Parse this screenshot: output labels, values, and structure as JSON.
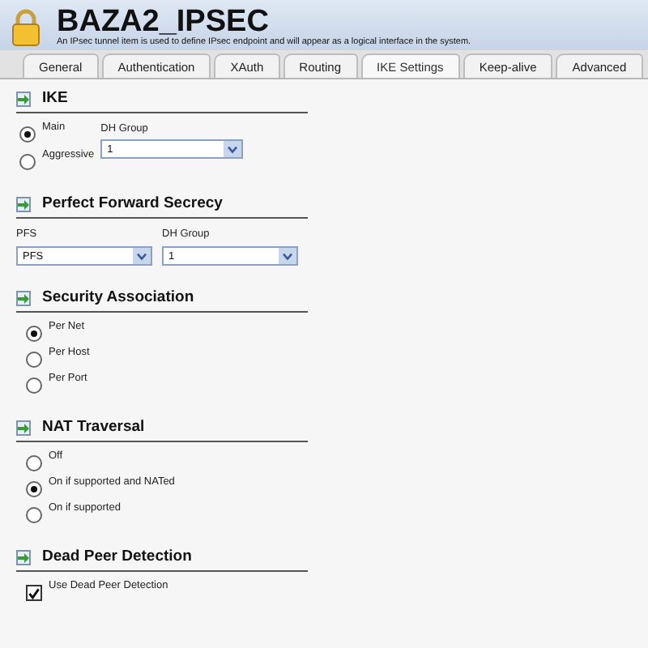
{
  "header": {
    "title": "BAZA2_IPSEC",
    "subtitle": "An IPsec tunnel item is used to define IPsec endpoint and will appear as a logical interface in the system."
  },
  "tabs": [
    {
      "label": "General",
      "selected": false
    },
    {
      "label": "Authentication",
      "selected": false
    },
    {
      "label": "XAuth",
      "selected": false
    },
    {
      "label": "Routing",
      "selected": false
    },
    {
      "label": "IKE Settings",
      "selected": true
    },
    {
      "label": "Keep-alive",
      "selected": false
    },
    {
      "label": "Advanced",
      "selected": false
    }
  ],
  "sections": [
    {
      "kind": "ike",
      "title": "IKE",
      "options": [
        {
          "label": "Main",
          "selected": true
        },
        {
          "label": "Aggressive",
          "selected": false
        }
      ],
      "dh_label": "DH Group",
      "dh_value": "1"
    },
    {
      "kind": "selects",
      "title": "Perfect Forward Secrecy",
      "fields": [
        {
          "label": "PFS",
          "value": "PFS"
        },
        {
          "label": "DH Group",
          "value": "1"
        }
      ]
    },
    {
      "kind": "radios",
      "title": "Security Association",
      "options": [
        {
          "label": "Per Net",
          "selected": true
        },
        {
          "label": "Per Host",
          "selected": false
        },
        {
          "label": "Per Port",
          "selected": false
        }
      ]
    },
    {
      "kind": "radios",
      "title": "NAT Traversal",
      "options": [
        {
          "label": "Off",
          "selected": false
        },
        {
          "label": "On if supported and NATed",
          "selected": true
        },
        {
          "label": "On if supported",
          "selected": false
        }
      ]
    },
    {
      "kind": "check",
      "title": "Dead Peer Detection",
      "label": "Use Dead Peer Detection",
      "checked": true
    }
  ]
}
